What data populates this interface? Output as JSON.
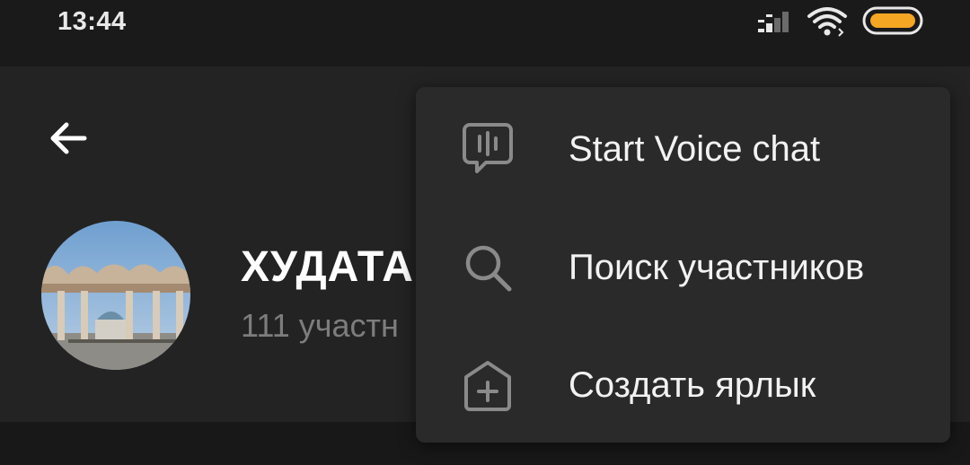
{
  "status_bar": {
    "time": "13:44",
    "icons": [
      "signal-icon",
      "wifi-icon",
      "battery-icon"
    ],
    "battery_color": "#f5a623"
  },
  "header": {
    "back_icon": "arrow-left-icon",
    "chat_title": "ХУДАТА",
    "chat_subtitle": "111 участн"
  },
  "menu": {
    "items": [
      {
        "icon": "voice-chat-icon",
        "label": "Start Voice chat"
      },
      {
        "icon": "search-icon",
        "label": "Поиск участников"
      },
      {
        "icon": "add-shortcut-icon",
        "label": "Создать ярлык"
      }
    ]
  },
  "colors": {
    "background": "#181818",
    "header": "#232323",
    "menu": "#2a2a2a",
    "text_primary": "#ffffff",
    "text_secondary": "#7d7d7d",
    "icon": "#8a8a8a"
  }
}
